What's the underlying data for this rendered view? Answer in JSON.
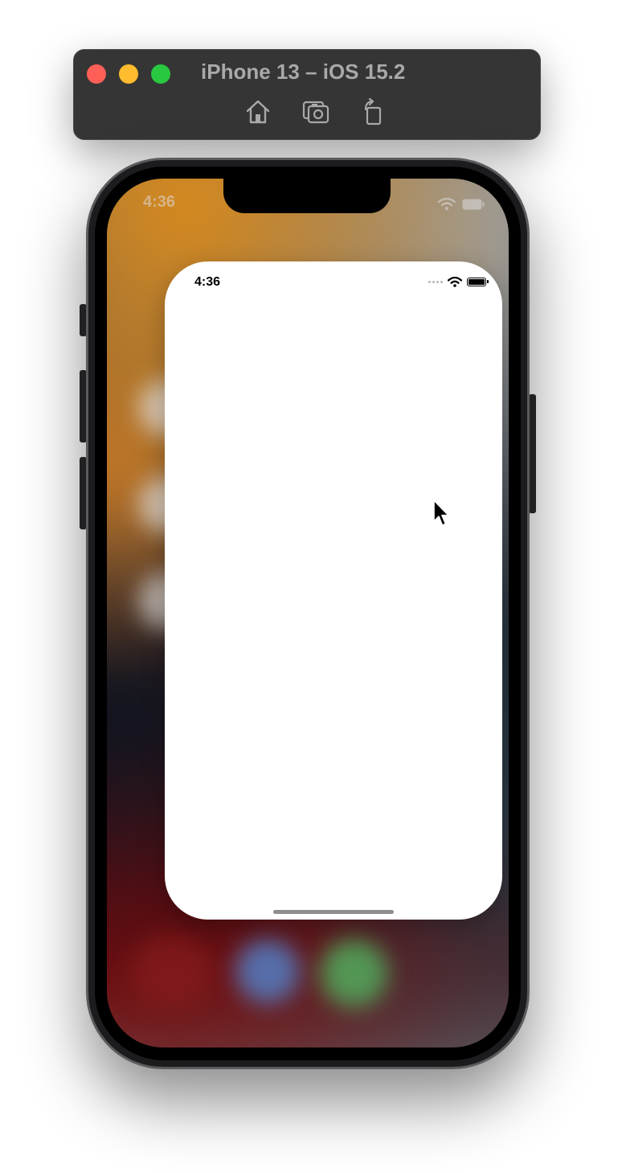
{
  "simulator": {
    "title": "iPhone 13 – iOS 15.2",
    "toolbar_buttons": [
      {
        "icon": "home-icon",
        "label": "Home"
      },
      {
        "icon": "screenshot-icon",
        "label": "Save Screen"
      },
      {
        "icon": "rotate-icon",
        "label": "Rotate"
      }
    ],
    "window_controls": [
      "close",
      "minimize",
      "maximize"
    ]
  },
  "device": {
    "background_status": {
      "time": "4:36"
    },
    "app_card": {
      "status_time": "4:36",
      "icons": [
        "cellular-signal-icon",
        "wifi-icon",
        "battery-icon"
      ]
    }
  },
  "colors": {
    "toolbar_bg": "#353535",
    "close": "#fe5f57",
    "minimize": "#febc2e",
    "maximize": "#28c840",
    "card_bg": "#ffffff"
  }
}
